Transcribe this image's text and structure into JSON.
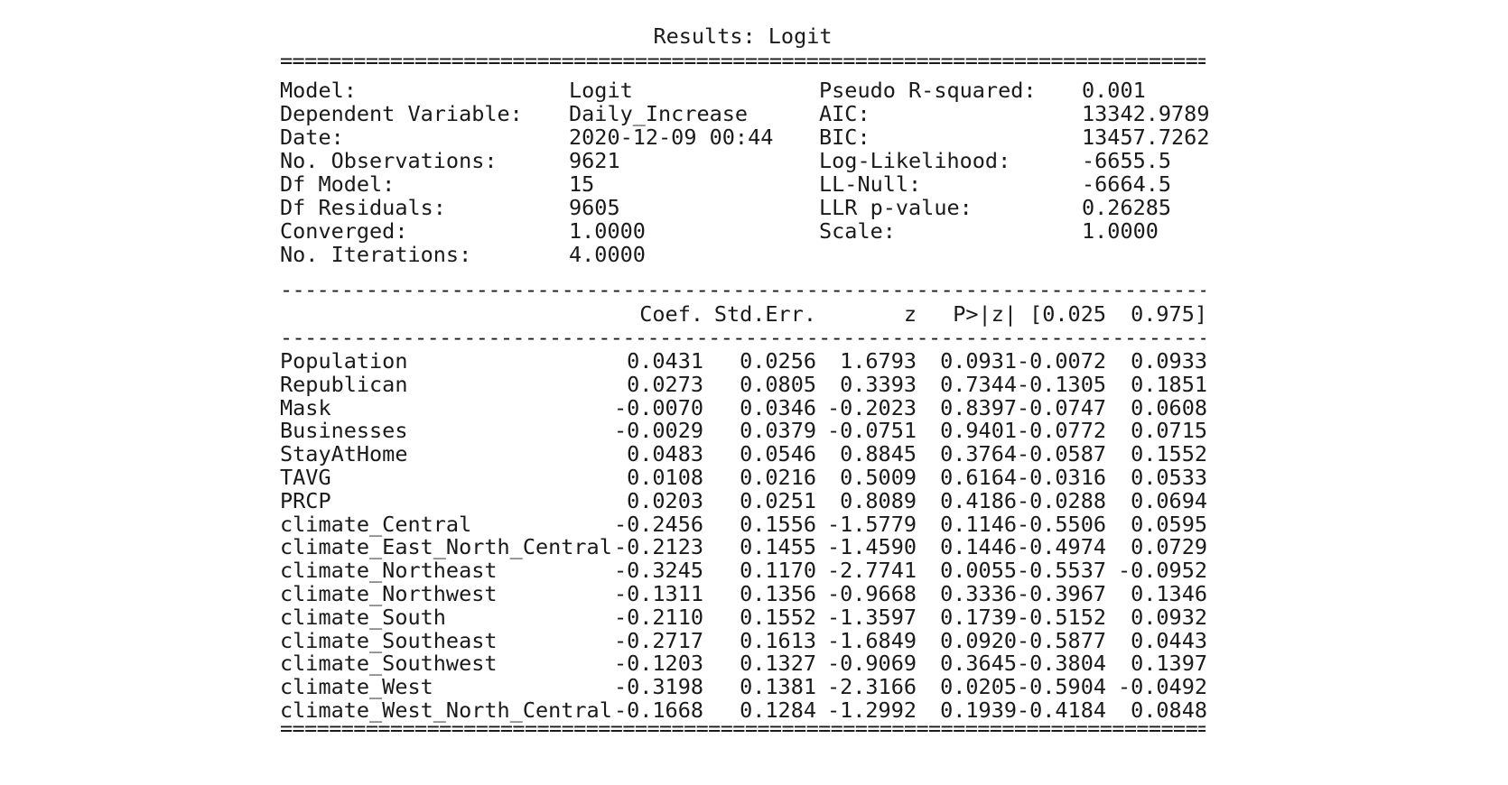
{
  "title": "Results: Logit",
  "rule_double": "============================================================================",
  "rule_single": "----------------------------------------------------------------------------",
  "summary": {
    "left": [
      {
        "label": "Model:",
        "value": "Logit"
      },
      {
        "label": "Dependent Variable:",
        "value": "Daily_Increase"
      },
      {
        "label": "Date:",
        "value": "2020-12-09 00:44"
      },
      {
        "label": "No. Observations:",
        "value": "9621"
      },
      {
        "label": "Df Model:",
        "value": "15"
      },
      {
        "label": "Df Residuals:",
        "value": "9605"
      },
      {
        "label": "Converged:",
        "value": "1.0000"
      },
      {
        "label": "No. Iterations:",
        "value": "4.0000"
      }
    ],
    "right": [
      {
        "label": "Pseudo R-squared:",
        "value": "0.001"
      },
      {
        "label": "AIC:",
        "value": "13342.9789"
      },
      {
        "label": "BIC:",
        "value": "13457.7262"
      },
      {
        "label": "Log-Likelihood:",
        "value": "-6655.5"
      },
      {
        "label": "LL-Null:",
        "value": "-6664.5"
      },
      {
        "label": "LLR p-value:",
        "value": "0.26285"
      },
      {
        "label": "Scale:",
        "value": "1.0000"
      }
    ]
  },
  "coef_table": {
    "headers": [
      "Coef.",
      "Std.Err.",
      "z",
      "P>|z|",
      "[0.025",
      "0.975]"
    ],
    "rows": [
      {
        "var": "Population",
        "vals": [
          "0.0431",
          "0.0256",
          "1.6793",
          "0.0931",
          "-0.0072",
          "0.0933"
        ]
      },
      {
        "var": "Republican",
        "vals": [
          "0.0273",
          "0.0805",
          "0.3393",
          "0.7344",
          "-0.1305",
          "0.1851"
        ]
      },
      {
        "var": "Mask",
        "vals": [
          "-0.0070",
          "0.0346",
          "-0.2023",
          "0.8397",
          "-0.0747",
          "0.0608"
        ]
      },
      {
        "var": "Businesses",
        "vals": [
          "-0.0029",
          "0.0379",
          "-0.0751",
          "0.9401",
          "-0.0772",
          "0.0715"
        ]
      },
      {
        "var": "StayAtHome",
        "vals": [
          "0.0483",
          "0.0546",
          "0.8845",
          "0.3764",
          "-0.0587",
          "0.1552"
        ]
      },
      {
        "var": "TAVG",
        "vals": [
          "0.0108",
          "0.0216",
          "0.5009",
          "0.6164",
          "-0.0316",
          "0.0533"
        ]
      },
      {
        "var": "PRCP",
        "vals": [
          "0.0203",
          "0.0251",
          "0.8089",
          "0.4186",
          "-0.0288",
          "0.0694"
        ]
      },
      {
        "var": "climate_Central",
        "vals": [
          "-0.2456",
          "0.1556",
          "-1.5779",
          "0.1146",
          "-0.5506",
          "0.0595"
        ]
      },
      {
        "var": "climate_East_North_Central",
        "vals": [
          "-0.2123",
          "0.1455",
          "-1.4590",
          "0.1446",
          "-0.4974",
          "0.0729"
        ]
      },
      {
        "var": "climate_Northeast",
        "vals": [
          "-0.3245",
          "0.1170",
          "-2.7741",
          "0.0055",
          "-0.5537",
          "-0.0952"
        ]
      },
      {
        "var": "climate_Northwest",
        "vals": [
          "-0.1311",
          "0.1356",
          "-0.9668",
          "0.3336",
          "-0.3967",
          "0.1346"
        ]
      },
      {
        "var": "climate_South",
        "vals": [
          "-0.2110",
          "0.1552",
          "-1.3597",
          "0.1739",
          "-0.5152",
          "0.0932"
        ]
      },
      {
        "var": "climate_Southeast",
        "vals": [
          "-0.2717",
          "0.1613",
          "-1.6849",
          "0.0920",
          "-0.5877",
          "0.0443"
        ]
      },
      {
        "var": "climate_Southwest",
        "vals": [
          "-0.1203",
          "0.1327",
          "-0.9069",
          "0.3645",
          "-0.3804",
          "0.1397"
        ]
      },
      {
        "var": "climate_West",
        "vals": [
          "-0.3198",
          "0.1381",
          "-2.3166",
          "0.0205",
          "-0.5904",
          "-0.0492"
        ]
      },
      {
        "var": "climate_West_North_Central",
        "vals": [
          "-0.1668",
          "0.1284",
          "-1.2992",
          "0.1939",
          "-0.4184",
          "0.0848"
        ]
      }
    ]
  }
}
